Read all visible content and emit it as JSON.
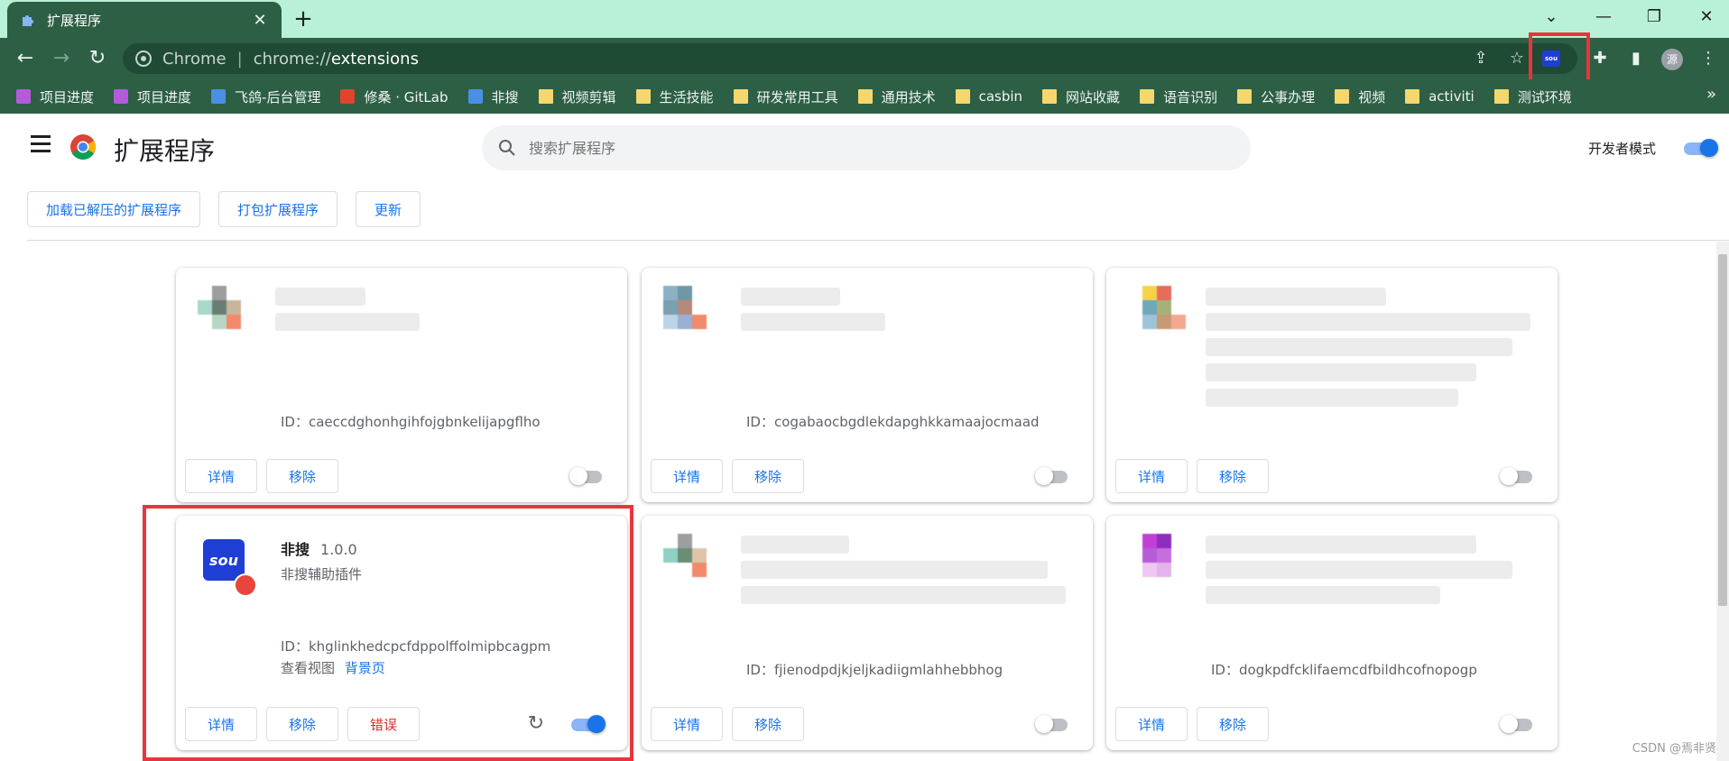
{
  "tab": {
    "title": "扩展程序"
  },
  "omnibox": {
    "site_name": "Chrome",
    "url_scheme": "chrome://",
    "url_host": "extensions"
  },
  "toolbar_ext": {
    "label": "sou"
  },
  "bookmarks": [
    {
      "label": "项目进度",
      "icon": "app-icon",
      "color": "#b55ad9"
    },
    {
      "label": "项目进度",
      "icon": "app-icon",
      "color": "#b55ad9"
    },
    {
      "label": "飞鸽-后台管理",
      "icon": "bird-icon",
      "color": "#4a90e2"
    },
    {
      "label": "修桑 · GitLab",
      "icon": "gitlab-icon",
      "color": "#e2432a"
    },
    {
      "label": "非搜",
      "icon": "bird-icon",
      "color": "#4a90e2"
    },
    {
      "label": "视频剪辑",
      "icon": "folder-icon",
      "color": "#f5d76e"
    },
    {
      "label": "生活技能",
      "icon": "folder-icon",
      "color": "#f5d76e"
    },
    {
      "label": "研发常用工具",
      "icon": "folder-icon",
      "color": "#f5d76e"
    },
    {
      "label": "通用技术",
      "icon": "folder-icon",
      "color": "#f5d76e"
    },
    {
      "label": "casbin",
      "icon": "folder-icon",
      "color": "#f5d76e"
    },
    {
      "label": "网站收藏",
      "icon": "folder-icon",
      "color": "#f5d76e"
    },
    {
      "label": "语音识别",
      "icon": "folder-icon",
      "color": "#f5d76e"
    },
    {
      "label": "公事办理",
      "icon": "folder-icon",
      "color": "#f5d76e"
    },
    {
      "label": "视频",
      "icon": "folder-icon",
      "color": "#f5d76e"
    },
    {
      "label": "activiti",
      "icon": "folder-icon",
      "color": "#f5d76e"
    },
    {
      "label": "测试环境",
      "icon": "folder-icon",
      "color": "#f5d76e"
    }
  ],
  "header": {
    "title": "扩展程序",
    "search_placeholder": "搜索扩展程序",
    "dev_mode_label": "开发者模式"
  },
  "actions": {
    "load_unpacked": "加载已解压的扩展程序",
    "pack": "打包扩展程序",
    "update": "更新"
  },
  "cards": [
    {
      "id": "ID：caeccdghonhgihfojgbnkelijapgflho",
      "enabled": false,
      "details": "详情",
      "remove": "移除"
    },
    {
      "id": "ID：cogabaocbgdlekdapghkkamaajocmaad",
      "enabled": false,
      "details": "详情",
      "remove": "移除"
    },
    {
      "id": "",
      "enabled": false,
      "details": "详情",
      "remove": "移除"
    },
    {
      "name": "非搜",
      "version": "1.0.0",
      "description": "非搜辅助插件",
      "id": "ID：khglinkhedcpcfdppolffolmipbcagpm",
      "inspect_label": "查看视图",
      "inspect_link": "背景页",
      "details": "详情",
      "remove": "移除",
      "errors": "错误",
      "enabled": true
    },
    {
      "id": "ID：fjienodpdjkjeljkadiigmlahhebbhog",
      "enabled": false,
      "details": "详情",
      "remove": "移除"
    },
    {
      "id": "ID：dogkpdfcklifaemcdfbildhcofnopogp",
      "enabled": false,
      "details": "详情",
      "remove": "移除"
    }
  ],
  "watermark": "CSDN @焉非贤",
  "colors": {
    "accent": "#1a73e8",
    "chrome_frame": "#2d5f45",
    "tabstrip": "#b9f0d8",
    "highlight": "#e8353b",
    "error": "#d93025"
  }
}
